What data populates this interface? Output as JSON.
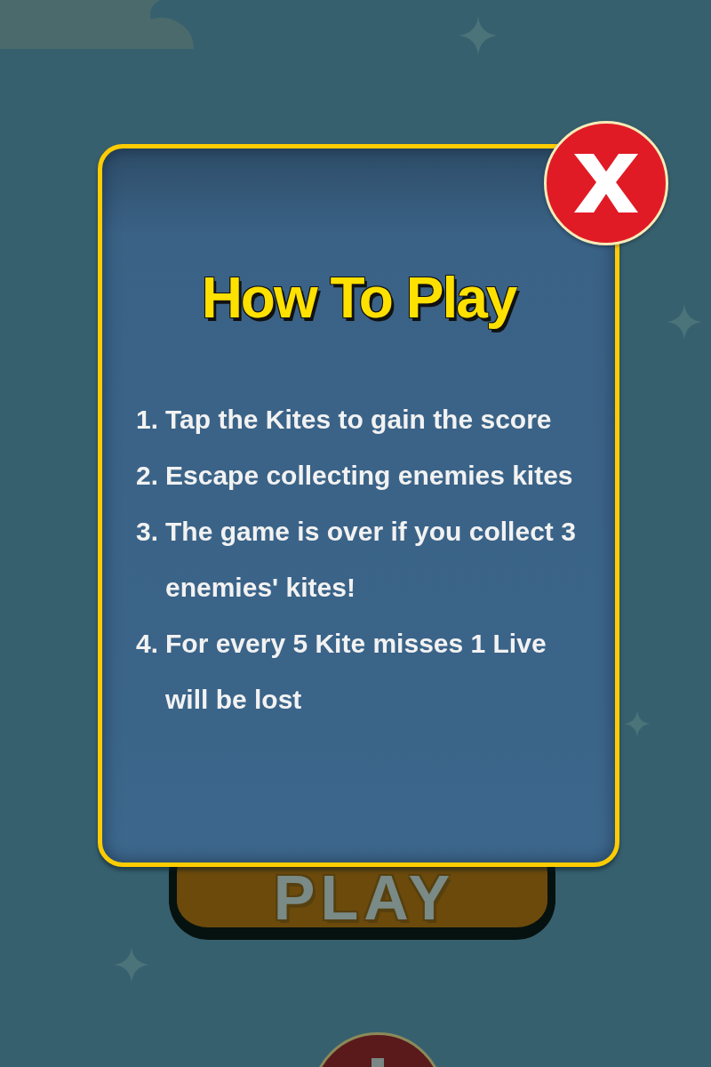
{
  "background": {
    "play_button": {
      "label": "PLAY"
    }
  },
  "dialog": {
    "title": "How To Play",
    "instructions": [
      {
        "number": "1.",
        "text": "Tap the Kites to gain the score"
      },
      {
        "number": "2.",
        "text": "Escape collecting enemies kites"
      },
      {
        "number": "3.",
        "text": "The game is over if you collect 3 enemies' kites!"
      },
      {
        "number": "4.",
        "text": "For every 5 Kite misses 1 Live will be lost"
      }
    ]
  }
}
